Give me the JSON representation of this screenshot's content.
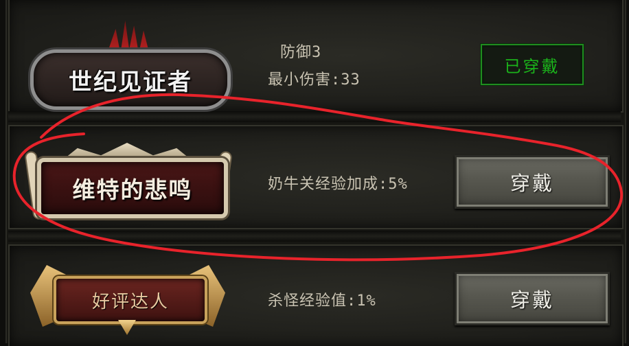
{
  "titles": [
    {
      "name": "世纪见证者",
      "stats": [
        "防御3",
        "最小伤害:33"
      ],
      "action": "已穿戴",
      "equipped": true
    },
    {
      "name": "维特的悲鸣",
      "stats": [
        "奶牛关经验加成:5%"
      ],
      "action": "穿戴",
      "equipped": false
    },
    {
      "name": "好评达人",
      "stats": [
        "杀怪经验值:1%"
      ],
      "action": "穿戴",
      "equipped": false
    }
  ],
  "colors": {
    "equipped_green": "#1bb31b",
    "annotation_red": "#e8232b"
  }
}
